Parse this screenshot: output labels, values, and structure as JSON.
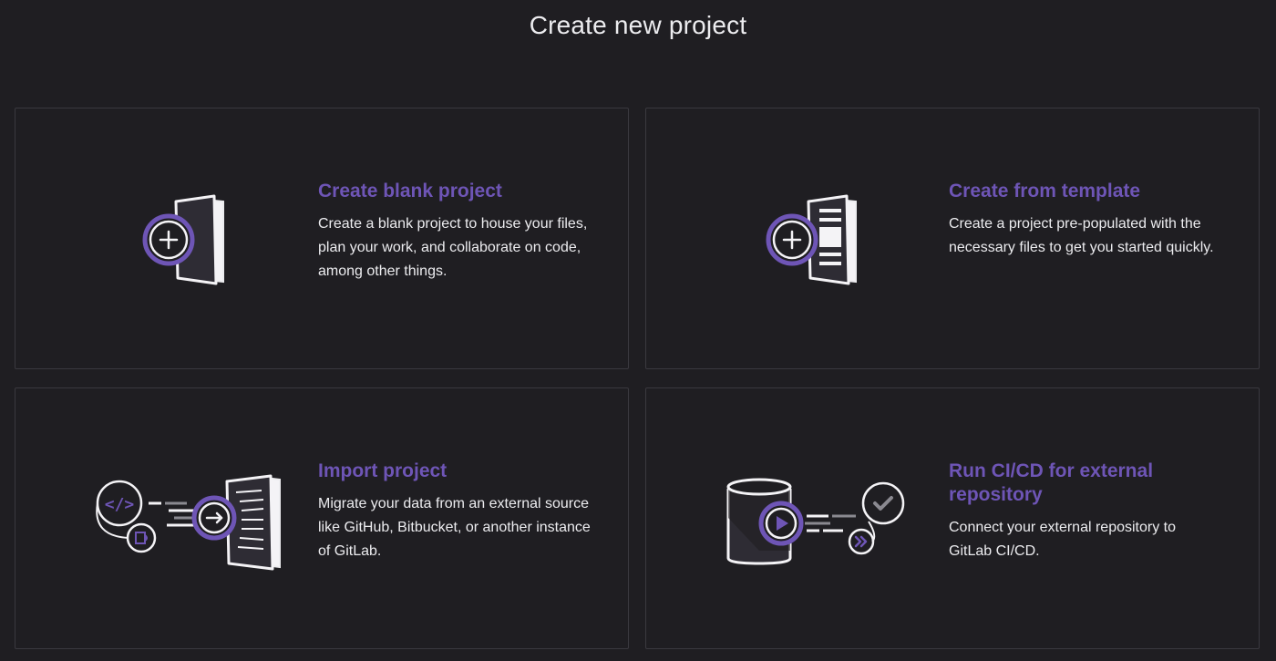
{
  "page": {
    "title": "Create new project"
  },
  "cards": [
    {
      "title": "Create blank project",
      "description": "Create a blank project to house your files, plan your work, and collaborate on code, among other things.",
      "icon": "blank-project-illustration"
    },
    {
      "title": "Create from template",
      "description": "Create a project pre-populated with the necessary files to get you started quickly.",
      "icon": "template-project-illustration"
    },
    {
      "title": "Import project",
      "description": "Migrate your data from an external source like GitHub, Bitbucket, or another instance of GitLab.",
      "icon": "import-project-illustration"
    },
    {
      "title": "Run CI/CD for external repository",
      "description": "Connect your external repository to GitLab CI/CD.",
      "icon": "cicd-project-illustration"
    }
  ],
  "colors": {
    "background": "#1f1e22",
    "accent": "#6e55b6",
    "text": "#ececef",
    "border": "#3a393f"
  }
}
